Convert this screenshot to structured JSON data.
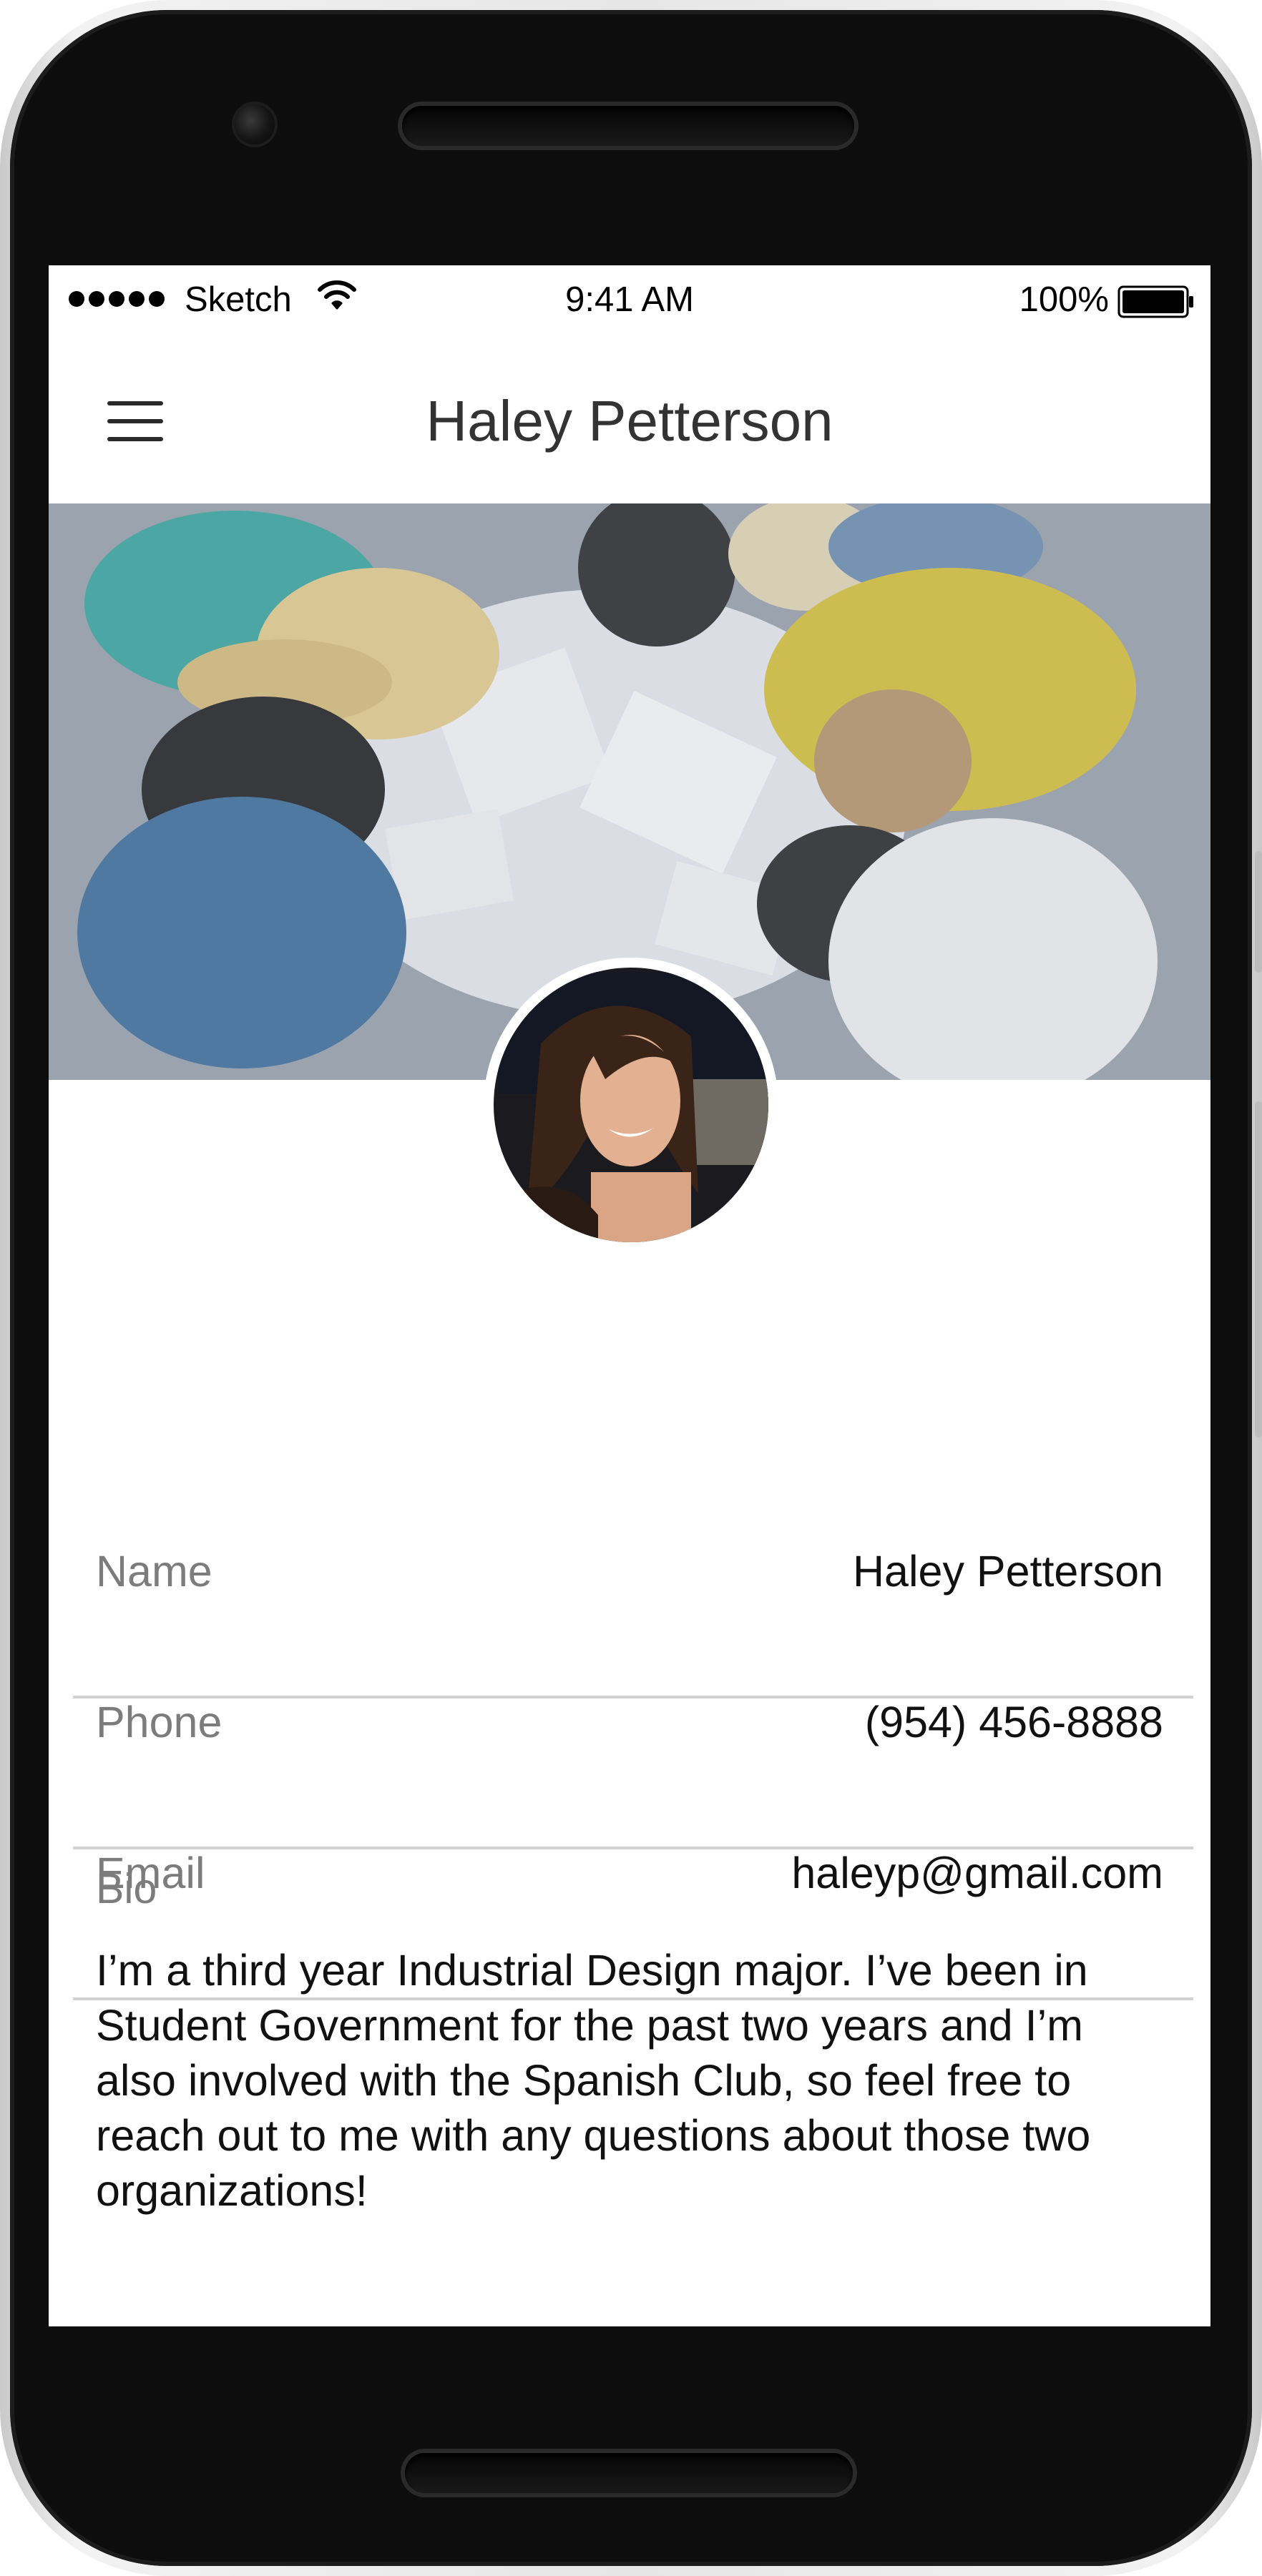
{
  "status_bar": {
    "carrier": "Sketch",
    "time": "9:41 AM",
    "battery": "100%"
  },
  "nav": {
    "title": "Haley Petterson",
    "menu_icon": "hamburger-menu-icon"
  },
  "profile": {
    "cover_image": "group-study-photo",
    "avatar_image": "profile-photo"
  },
  "fields": {
    "name": {
      "label": "Name",
      "value": "Haley Petterson"
    },
    "phone": {
      "label": "Phone",
      "value": "(954) 456-8888"
    },
    "email": {
      "label": "Email",
      "value": "haleyp@gmail.com"
    },
    "bio": {
      "label": "Bio",
      "value": "I’m a third year Industrial Design major. I’ve been in Student Government for the past two years and I’m also involved with the Spanish Club, so feel free to reach out to me with any questions about those two organizations!"
    }
  }
}
